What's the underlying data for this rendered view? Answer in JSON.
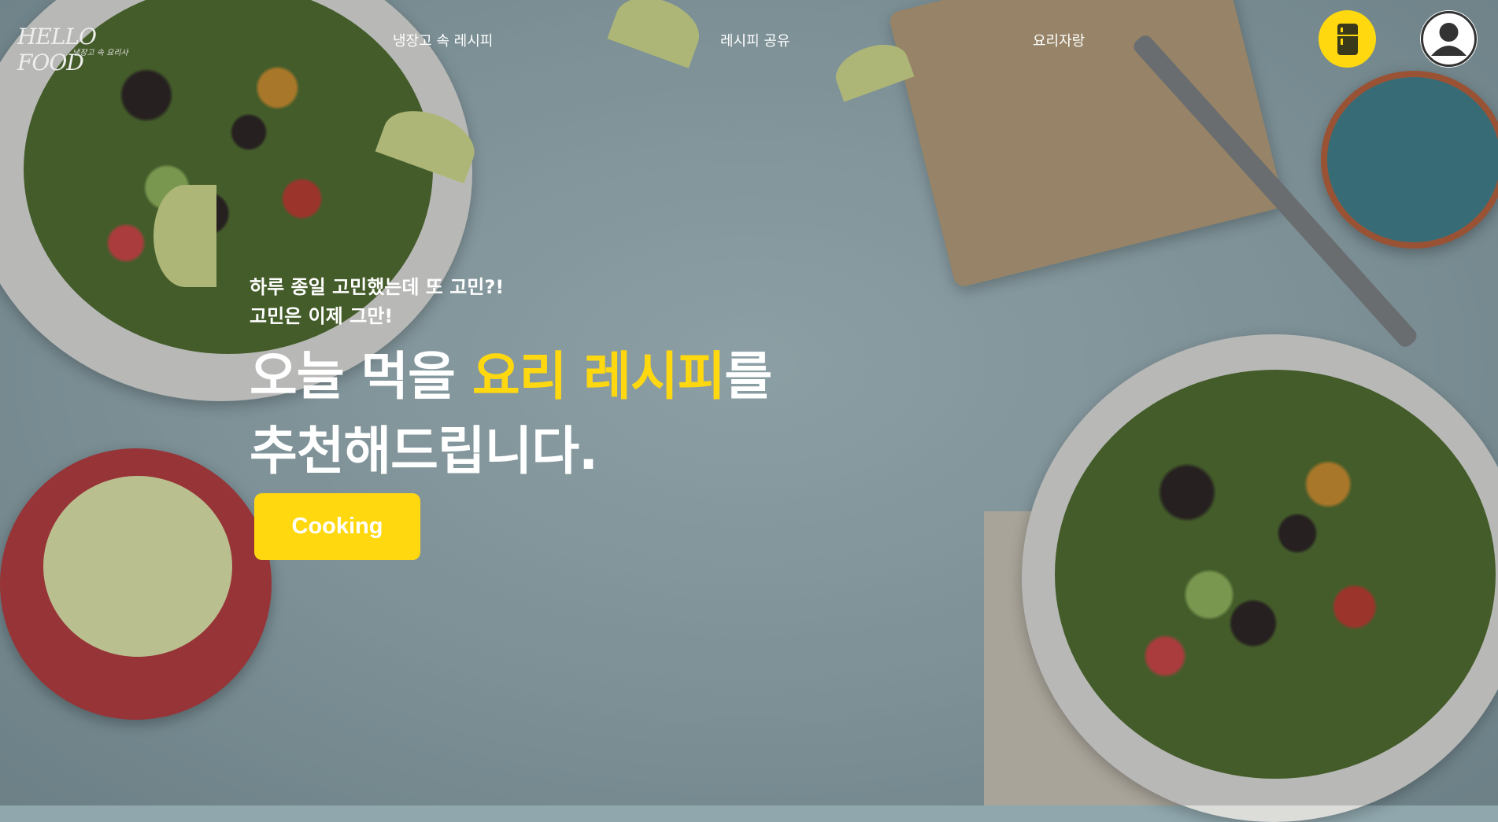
{
  "header": {
    "logo_text": "HELLO FOOD",
    "logo_subtext": "냉장고 속 요리사",
    "nav": [
      {
        "label": "냉장고 속 레시피"
      },
      {
        "label": "레시피 공유"
      },
      {
        "label": "요리자랑"
      }
    ],
    "fridge_icon": "fridge-icon",
    "profile_icon": "user-icon"
  },
  "hero": {
    "tagline_line1": "하루 종일 고민했는데 또 고민?!",
    "tagline_line2": "고민은 이제 그만!",
    "headline_part1": "오늘 먹을 ",
    "headline_highlight": "요리 레시피",
    "headline_part2": "를",
    "headline_line2": "추천해드립니다.",
    "cta_label": "Cooking"
  },
  "colors": {
    "accent": "#ffd810",
    "text": "#ffffff",
    "background": "#93aab0"
  }
}
